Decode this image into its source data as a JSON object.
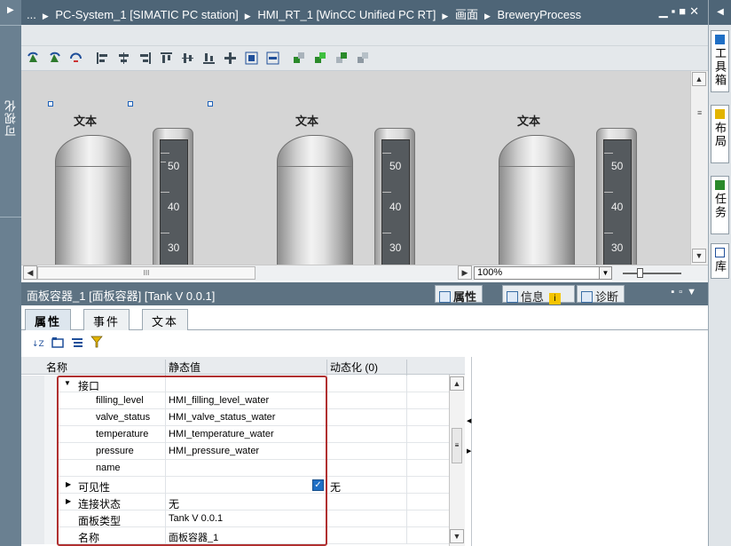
{
  "left_panel": {
    "label": "可视化"
  },
  "breadcrumb": {
    "items": [
      "...",
      "PC-System_1 [SIMATIC PC station]",
      "HMI_RT_1 [WinCC Unified PC RT]",
      "画面",
      "BreweryProcess"
    ]
  },
  "canvas": {
    "tanks": [
      {
        "label": "文本",
        "gauge": [
          "50",
          "40",
          "30"
        ]
      },
      {
        "label": "文本",
        "gauge": [
          "50",
          "40",
          "30"
        ]
      },
      {
        "label": "文本",
        "gauge": [
          "50",
          "40",
          "30"
        ]
      }
    ],
    "hscroll_mark": "III",
    "zoom": "100%"
  },
  "inspector": {
    "title": "面板容器_1 [面板容器] [Tank V 0.0.1]",
    "tabs": [
      "属性",
      "信息",
      "诊断"
    ],
    "subtabs": [
      "属性",
      "事件",
      "文本"
    ],
    "columns": {
      "name": "名称",
      "static": "静态值",
      "dynamic": "动态化 (0)"
    },
    "rows": [
      {
        "name": "接口",
        "value": "",
        "level": 0,
        "expander": "▼"
      },
      {
        "name": "filling_level",
        "value": "HMI_filling_level_water",
        "level": 1,
        "expander": ""
      },
      {
        "name": "valve_status",
        "value": "HMI_valve_status_water",
        "level": 1,
        "expander": ""
      },
      {
        "name": "temperature",
        "value": "HMI_temperature_water",
        "level": 1,
        "expander": ""
      },
      {
        "name": "pressure",
        "value": "HMI_pressure_water",
        "level": 1,
        "expander": ""
      },
      {
        "name": "name",
        "value": "",
        "level": 1,
        "expander": ""
      },
      {
        "name": "可见性",
        "value": "",
        "level": 0,
        "expander": "▶",
        "checkbox_label": "无"
      },
      {
        "name": "连接状态",
        "value": "无",
        "level": 0,
        "expander": "▶"
      },
      {
        "name": "面板类型",
        "value": "Tank V 0.0.1",
        "level": 0,
        "expander": ""
      },
      {
        "name": "名称",
        "value": "面板容器_1",
        "level": 0,
        "expander": ""
      }
    ]
  },
  "right_panel": {
    "tabs": [
      "工具箱",
      "布局",
      "任务",
      "库"
    ]
  },
  "colors": {
    "title_bar": "#4e6577",
    "highlight": "#b03030",
    "accent": "#1b5fb7"
  }
}
